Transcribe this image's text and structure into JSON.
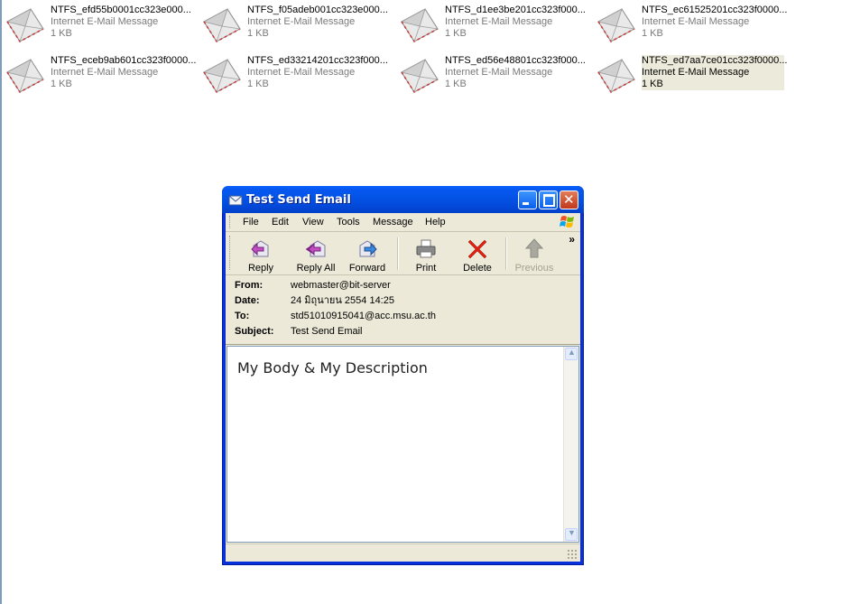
{
  "files": [
    {
      "name": "NTFS_efd55b0001cc323e000...",
      "type": "Internet E-Mail Message",
      "size": "1 KB",
      "selected": false
    },
    {
      "name": "NTFS_f05adeb001cc323e000...",
      "type": "Internet E-Mail Message",
      "size": "1 KB",
      "selected": false
    },
    {
      "name": "NTFS_d1ee3be201cc323f000...",
      "type": "Internet E-Mail Message",
      "size": "1 KB",
      "selected": false
    },
    {
      "name": "NTFS_ec61525201cc323f0000...",
      "type": "Internet E-Mail Message",
      "size": "1 KB",
      "selected": false
    },
    {
      "name": "NTFS_eceb9ab601cc323f0000...",
      "type": "Internet E-Mail Message",
      "size": "1 KB",
      "selected": false
    },
    {
      "name": "NTFS_ed33214201cc323f000...",
      "type": "Internet E-Mail Message",
      "size": "1 KB",
      "selected": false
    },
    {
      "name": "NTFS_ed56e48801cc323f000...",
      "type": "Internet E-Mail Message",
      "size": "1 KB",
      "selected": false
    },
    {
      "name": "NTFS_ed7aa7ce01cc323f0000...",
      "type": "Internet E-Mail Message",
      "size": "1 KB",
      "selected": true
    }
  ],
  "window": {
    "title": "Test Send Email",
    "icon": "envelope-icon",
    "menu": [
      "File",
      "Edit",
      "View",
      "Tools",
      "Message",
      "Help"
    ],
    "toolbar": {
      "reply": "Reply",
      "reply_all": "Reply All",
      "forward": "Forward",
      "print": "Print",
      "delete": "Delete",
      "previous": "Previous",
      "more": "»"
    },
    "header": {
      "from_label": "From:",
      "from": "webmaster@bit-server",
      "date_label": "Date:",
      "date": "24 มิถุนายน 2554 14:25",
      "to_label": "To:",
      "to": "std51010915041@acc.msu.ac.th",
      "subject_label": "Subject:",
      "subject": "Test Send Email"
    },
    "body": "My Body & My Description"
  },
  "colors": {
    "titlebar": "#0454e8",
    "window_face": "#ece9d8",
    "selected_bg": "#ecebdb",
    "close_button": "#c1381a"
  }
}
